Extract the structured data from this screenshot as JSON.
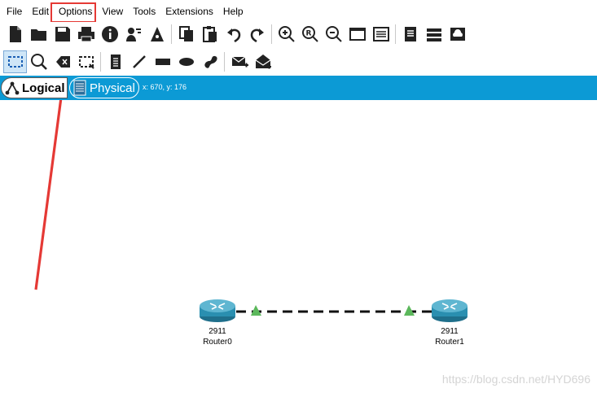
{
  "menu": {
    "file": "File",
    "edit": "Edit",
    "options": "Options",
    "view": "View",
    "tools": "Tools",
    "extensions": "Extensions",
    "help": "Help"
  },
  "toolbar1": [
    "new-file-icon",
    "open-folder-icon",
    "save-icon",
    "print-icon",
    "info-icon",
    "network-wizard-icon",
    "activity-wizard-icon",
    "copy-icon",
    "paste-icon",
    "undo-icon",
    "redo-icon",
    "zoom-in-icon",
    "zoom-reset-icon",
    "zoom-out-icon",
    "drawing-palette-icon",
    "custom-devices-icon",
    "report-icon",
    "device-list-icon",
    "cloud-view-icon"
  ],
  "toolbar2": [
    "select-icon",
    "inspect-icon",
    "delete-icon",
    "resize-icon",
    "note-icon",
    "line-icon",
    "rectangle-icon",
    "ellipse-icon",
    "freeform-icon",
    "add-simple-pdu-icon",
    "add-complex-pdu-icon"
  ],
  "workspace": {
    "logical_label": "Logical",
    "physical_label": "Physical",
    "coordinates": "x: 670, y: 176"
  },
  "devices": [
    {
      "model": "2911",
      "name": "Router0"
    },
    {
      "model": "2911",
      "name": "Router1"
    }
  ],
  "link": {
    "color": "#000000",
    "port_status_color": "#5cb85c"
  },
  "watermark": "https://blog.csdn.net/HYD696",
  "colors": {
    "workspace_bar": "#0c9ad5",
    "annotation": "#e53935"
  }
}
